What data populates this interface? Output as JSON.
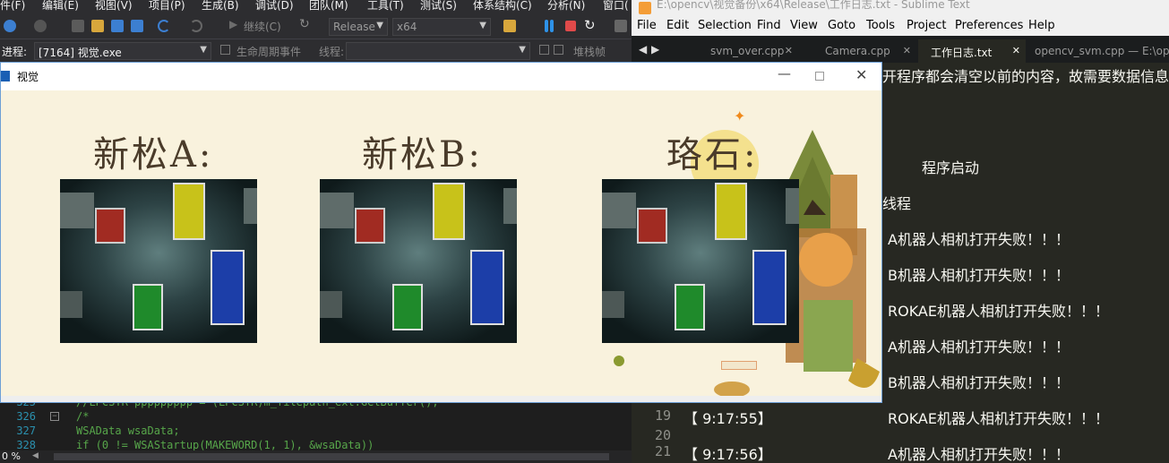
{
  "vs": {
    "menu": [
      "件(F)",
      "编辑(E)",
      "视图(V)",
      "项目(P)",
      "生成(B)",
      "调试(D)",
      "团队(M)",
      "工具(T)",
      "测试(S)",
      "体系结构(C)",
      "分析(N)",
      "窗口("
    ],
    "toolbar": {
      "continue_label": "继续(C)",
      "config": "Release",
      "platform": "x64"
    },
    "process_label": "进程:",
    "process_value": "[7164] 视觉.exe",
    "lifecycle_label": "生命周期事件",
    "thread_label": "线程:",
    "stack_label": "堆栈帧",
    "code_lines": [
      {
        "n": "325",
        "t": "//LPCSTR ppppppppp = (LPCSTR)m_filepath_ext.GetBuffer();"
      },
      {
        "n": "326",
        "t": "/*"
      },
      {
        "n": "327",
        "t": "WSAData wsaData;"
      },
      {
        "n": "328",
        "t": "if (0 != WSAStartup(MAKEWORD(1, 1), &wsaData))"
      }
    ],
    "zoom": "0 %"
  },
  "sublime": {
    "title": "E:\\opencv\\视觉备份\\x64\\Release\\工作日志.txt - Sublime Text",
    "menu": [
      "File",
      "Edit",
      "Selection",
      "Find",
      "View",
      "Goto",
      "Tools",
      "Project",
      "Preferences",
      "Help"
    ],
    "tabs": [
      {
        "label": "svm_over.cpp",
        "active": false
      },
      {
        "label": "Camera.cpp",
        "active": false
      },
      {
        "label": "工作日志.txt",
        "active": true
      },
      {
        "label": "opencv_svm.cpp — E:\\opencv\\",
        "active": false
      }
    ],
    "top_text": "开程序都会清空以前的内容，故需要数据信息",
    "program_start": "程序启动",
    "thread_text": "线程",
    "log": [
      {
        "text": "A机器人相机打开失败！！！"
      },
      {
        "text": "B机器人相机打开失败！！！"
      },
      {
        "text": "ROKAE机器人相机打开失败！！！"
      },
      {
        "text": "A机器人相机打开失败！！！"
      },
      {
        "text": "B机器人相机打开失败！！！"
      },
      {
        "n": "19",
        "time": "【 9:17:55】",
        "text": "ROKAE机器人相机打开失败！！！"
      },
      {
        "n": "20",
        "time": "",
        "text": ""
      },
      {
        "n": "21",
        "time": "【 9:17:56】",
        "text": "A机器人相机打开失败！！！"
      }
    ]
  },
  "dialog": {
    "title": "视觉",
    "panels": [
      {
        "label": "新松A:"
      },
      {
        "label": "新松B:"
      },
      {
        "label": "珞石:"
      }
    ]
  },
  "colors": {
    "sublime_bg": "#272822",
    "dialog_bg": "#f9f2dd",
    "lego_red": "#a12b22",
    "lego_yellow": "#c8c21a",
    "lego_green": "#1f8a2b",
    "lego_blue": "#1c3ea8"
  }
}
